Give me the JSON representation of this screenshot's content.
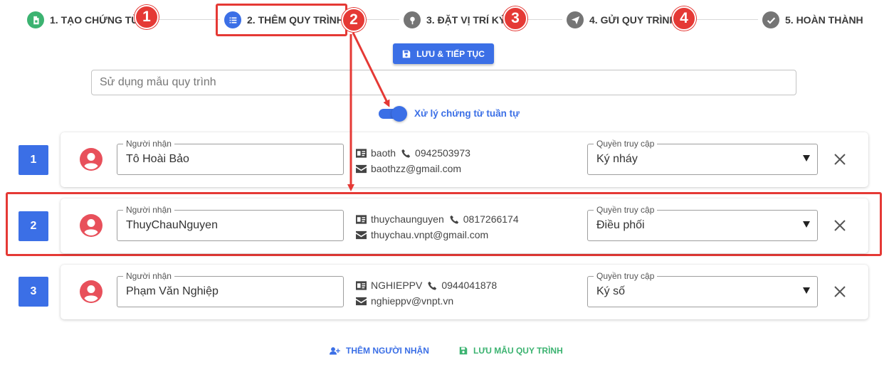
{
  "stepper": {
    "steps": [
      {
        "label": "1. TẠO CHỨNG TỪ",
        "icon": "document-icon",
        "state": "done",
        "color": "#3cb371"
      },
      {
        "label": "2. THÊM QUY TRÌNH",
        "icon": "list-icon",
        "state": "active",
        "color": "#3b6fe6"
      },
      {
        "label": "3. ĐẶT VỊ TRÍ KÝ",
        "icon": "pin-icon",
        "state": "pending",
        "color": "#757575"
      },
      {
        "label": "4. GỬI QUY TRÌNH",
        "icon": "send-icon",
        "state": "pending",
        "color": "#757575"
      },
      {
        "label": "5. HOÀN THÀNH",
        "icon": "check-icon",
        "state": "pending",
        "color": "#757575"
      }
    ],
    "badges": [
      "1",
      "2",
      "3",
      "4"
    ]
  },
  "toolbar": {
    "save_continue_label": "LƯU & TIẾP TỤC"
  },
  "template": {
    "placeholder": "Sử dụng mẫu quy trình"
  },
  "sequential": {
    "label": "Xử lý chứng từ tuần tự",
    "enabled": true
  },
  "annotations": {
    "row_badge": "2"
  },
  "recipients": [
    {
      "index": "1",
      "name_legend": "Người nhận",
      "name": "Tô Hoài Bảo",
      "username": "baoth",
      "phone": "0942503973",
      "email": "baothzz@gmail.com",
      "perm_legend": "Quyền truy cập",
      "permission": "Ký nháy"
    },
    {
      "index": "2",
      "name_legend": "Người nhận",
      "name": "ThuyChauNguyen",
      "username": "thuychaunguyen",
      "phone": "0817266174",
      "email": "thuychau.vnpt@gmail.com",
      "perm_legend": "Quyền truy cập",
      "permission": "Điều phối"
    },
    {
      "index": "3",
      "name_legend": "Người nhận",
      "name": "Phạm Văn Nghiệp",
      "username": "NGHIEPPV",
      "phone": "0944041878",
      "email": "nghieppv@vnpt.vn",
      "perm_legend": "Quyền truy cập",
      "permission": "Ký số"
    }
  ],
  "footer": {
    "add_recipient_label": "THÊM NGƯỜI NHẬN",
    "save_template_label": "LƯU MẪU QUY TRÌNH"
  },
  "colors": {
    "primary": "#3b6fe6",
    "success": "#3cb371",
    "danger": "#e53935",
    "avatar": "#e8505b"
  }
}
